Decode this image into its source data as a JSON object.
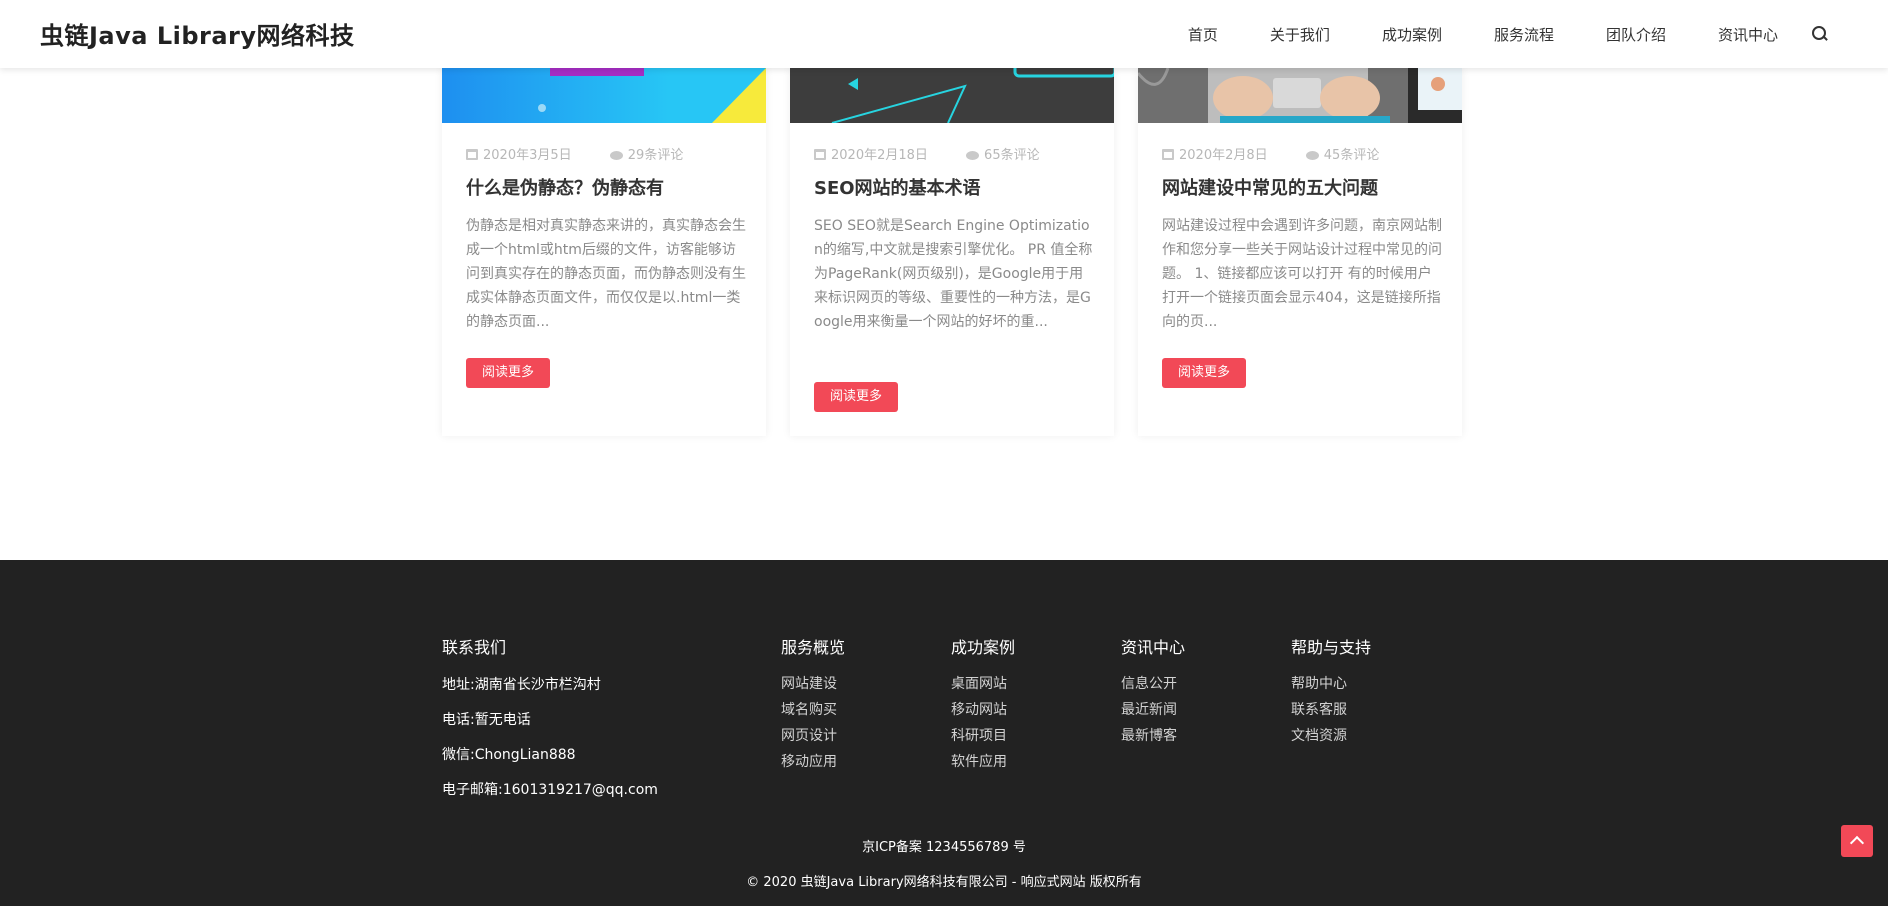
{
  "header": {
    "logo": "虫链Java Library网络科技",
    "nav": [
      "首页",
      "关于我们",
      "成功案例",
      "服务流程",
      "团队介绍",
      "资讯中心"
    ],
    "search_icon": "search-icon"
  },
  "posts": [
    {
      "date": "2020年3月5日",
      "comments": "29条评论",
      "title": "什么是伪静态？伪静态有",
      "excerpt": "伪静态是相对真实静态来讲的，真实静态会生成一个html或htm后缀的文件，访客能够访问到真实存在的静态页面，而伪静态则没有生成实体静态页面文件，而仅仅是以.html一类的静态页面...",
      "button": "阅读更多"
    },
    {
      "date": "2020年2月18日",
      "comments": "65条评论",
      "title": "SEO网站的基本术语",
      "excerpt": "SEO SEO就是Search Engine Optimization的缩写,中文就是搜索引擎优化。 PR 值全称为PageRank(网页级别)，是Google用于用来标识网页的等级、重要性的一种方法，是Google用来衡量一个网站的好坏的重...",
      "button": "阅读更多"
    },
    {
      "date": "2020年2月8日",
      "comments": "45条评论",
      "title": "网站建设中常见的五大问题",
      "excerpt": "网站建设过程中会遇到许多问题，南京网站制作和您分享一些关于网站设计过程中常见的问题。 1、链接都应该可以打开 有的时候用户打开一个链接页面会显示404，这是链接所指向的页...",
      "button": "阅读更多"
    }
  ],
  "footer": {
    "contact": {
      "title": "联系我们",
      "address": "地址:湖南省长沙市栏沟村",
      "phone": "电话:暂无电话",
      "wechat": "微信:ChongLian888",
      "email": "电子邮箱:1601319217@qq.com"
    },
    "columns": [
      {
        "title": "服务概览",
        "items": [
          "网站建设",
          "域名购买",
          "网页设计",
          "移动应用"
        ]
      },
      {
        "title": "成功案例",
        "items": [
          "桌面网站",
          "移动网站",
          "科研项目",
          "软件应用"
        ]
      },
      {
        "title": "资讯中心",
        "items": [
          "信息公开",
          "最近新闻",
          "最新博客"
        ]
      },
      {
        "title": "帮助与支持",
        "items": [
          "帮助中心",
          "联系客服",
          "文档资源"
        ]
      }
    ],
    "icp": "京ICP备案 1234556789 号",
    "copyright": "© 2020 虫链Java Library网络科技有限公司 - 响应式网站 版权所有"
  },
  "back_to_top_icon": "chevron-up-icon"
}
